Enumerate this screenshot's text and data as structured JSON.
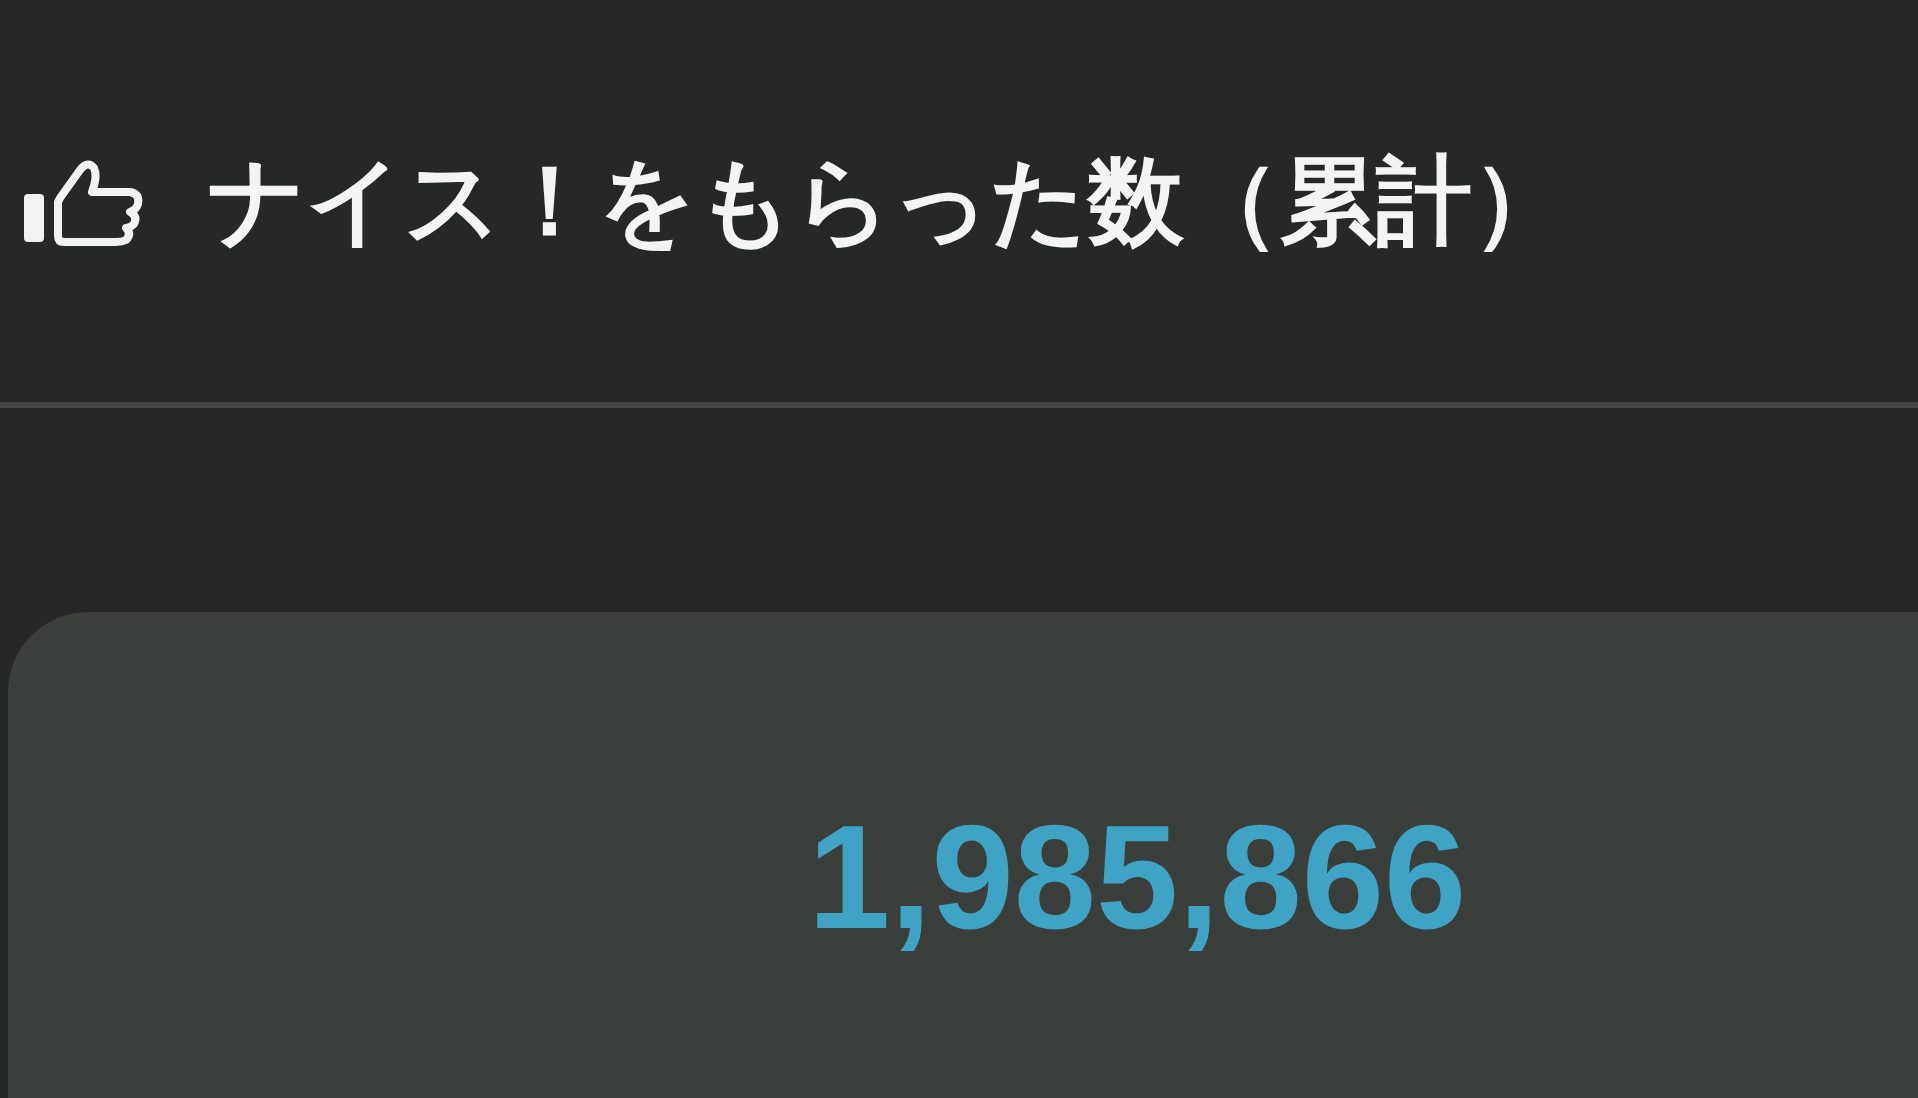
{
  "header": {
    "title": "ナイス！をもらった数（累計）"
  },
  "stat": {
    "value": "1,985,866"
  }
}
